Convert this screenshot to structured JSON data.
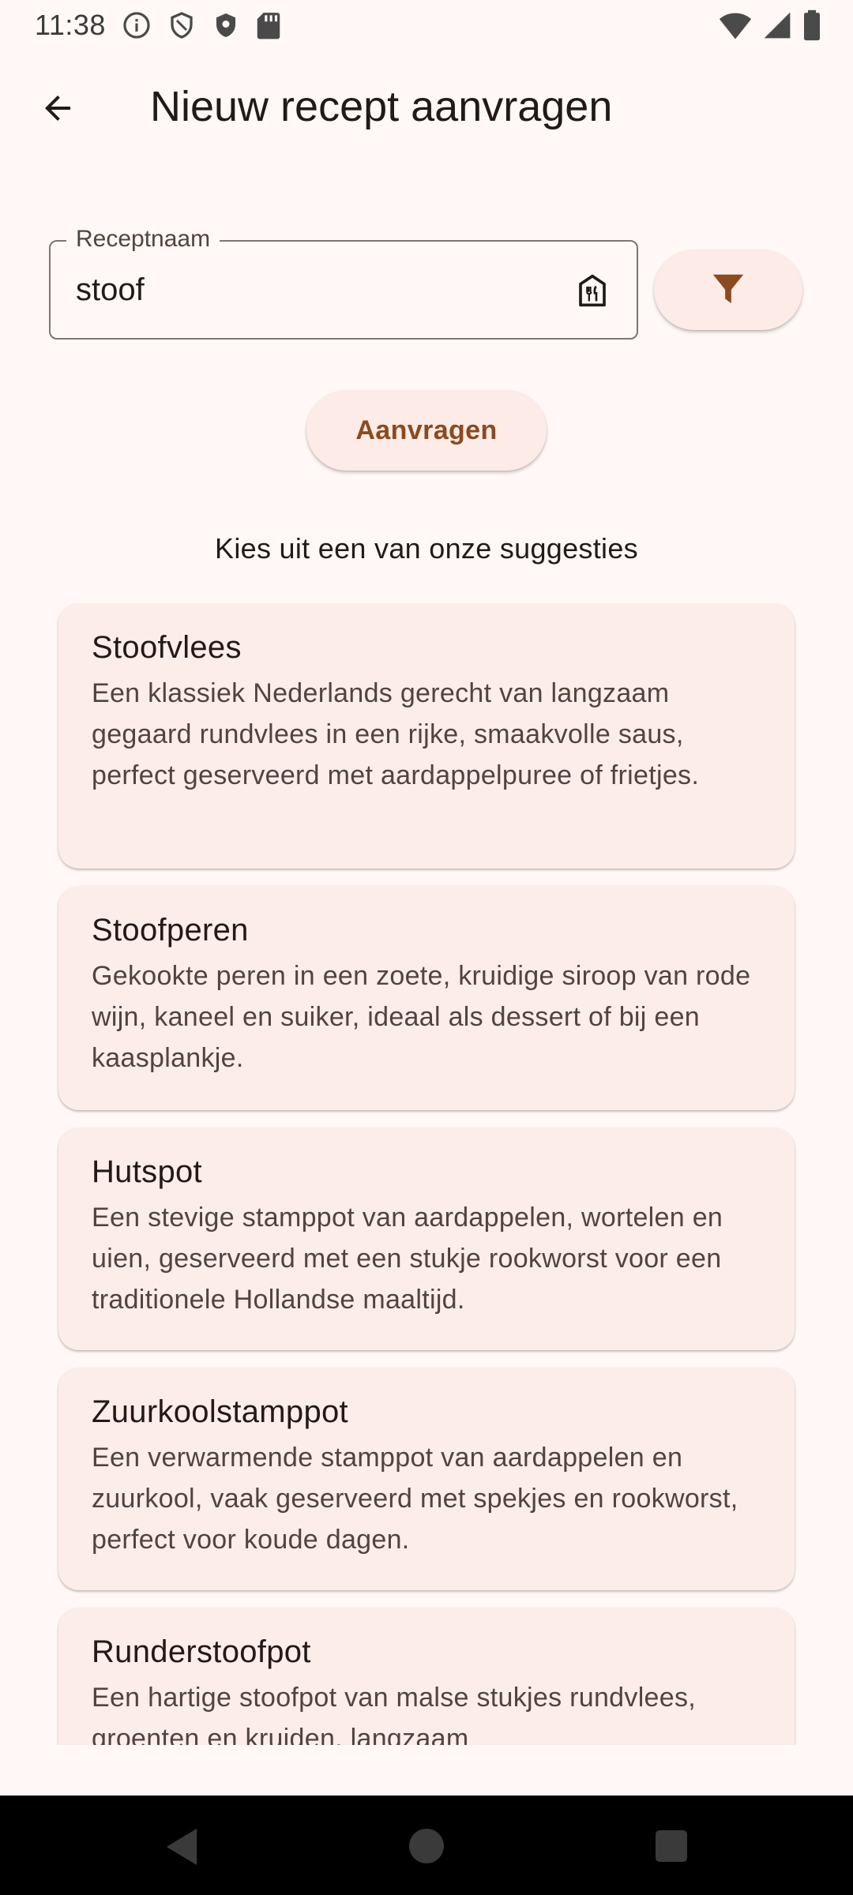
{
  "status_bar": {
    "time": "11:38",
    "icons_left": [
      "info-icon",
      "shield-outline-icon",
      "shield-filled-icon",
      "sd-card-icon"
    ],
    "icons_right": [
      "wifi-icon",
      "signal-icon",
      "battery-icon"
    ]
  },
  "app_bar": {
    "title": "Nieuw recept aanvragen",
    "back_icon": "arrow-back-icon"
  },
  "recipe_field": {
    "label": "Receptnaam",
    "value": "stoof",
    "trailing_icon": "restaurant-home-icon"
  },
  "filter_button": {
    "icon": "filter-icon"
  },
  "request_button": {
    "label": "Aanvragen"
  },
  "suggestions": {
    "heading": "Kies uit een van onze suggesties",
    "items": [
      {
        "title": "Stoofvlees",
        "description": "Een klassiek Nederlands gerecht van langzaam gegaard rundvlees in een rijke, smaakvolle saus, perfect geserveerd met aardappelpuree of frietjes."
      },
      {
        "title": "Stoofperen",
        "description": "Gekookte peren in een zoete, kruidige siroop van rode wijn, kaneel en suiker, ideaal als dessert of bij een kaasplankje."
      },
      {
        "title": "Hutspot",
        "description": "Een stevige stamppot van aardappelen, wortelen en uien, geserveerd met een stukje rookworst voor een traditionele Hollandse maaltijd."
      },
      {
        "title": "Zuurkoolstamppot",
        "description": "Een verwarmende stamppot van aardappelen en zuurkool, vaak geserveerd met spekjes en rookworst, perfect voor koude dagen."
      },
      {
        "title": "Runderstoofpot",
        "description": "Een hartige stoofpot van malse stukjes rundvlees, groenten en kruiden, langzaam"
      }
    ]
  },
  "colors": {
    "background": "#fff8f6",
    "card": "#fdede9",
    "button": "#fcebe6",
    "accent": "#8b4a1f",
    "filter_icon": "#8b4a1f"
  },
  "nav_bar": {
    "items": [
      "nav-back-icon",
      "nav-home-icon",
      "nav-recents-icon"
    ]
  }
}
